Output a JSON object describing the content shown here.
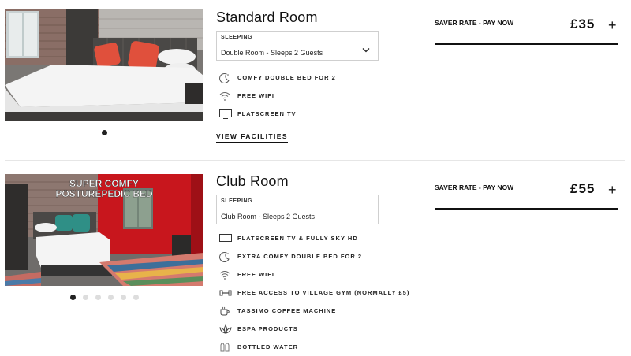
{
  "rooms": [
    {
      "title": "Standard Room",
      "sleeping_label": "SLEEPING",
      "sleeping_value": "Double Room - Sleeps 2 Guests",
      "has_dropdown": true,
      "features": [
        {
          "icon": "moon-icon",
          "text": "COMFY DOUBLE BED FOR 2"
        },
        {
          "icon": "wifi-icon",
          "text": "FREE WIFI"
        },
        {
          "icon": "tv-icon",
          "text": "FLATSCREEN TV"
        }
      ],
      "view_facilities": "VIEW FACILITIES",
      "rate_label": "SAVER RATE - PAY NOW",
      "price": "£35",
      "add_symbol": "+",
      "carousel_count": 1,
      "carousel_active": 0,
      "photo_overlay": ""
    },
    {
      "title": "Club Room",
      "sleeping_label": "SLEEPING",
      "sleeping_value": "Club Room - Sleeps 2 Guests",
      "has_dropdown": false,
      "features": [
        {
          "icon": "tv-icon",
          "text": "FLATSCREEN TV & FULLY SKY HD"
        },
        {
          "icon": "moon-icon",
          "text": "EXTRA COMFY DOUBLE BED FOR 2"
        },
        {
          "icon": "wifi-icon",
          "text": "FREE WIFI"
        },
        {
          "icon": "dumbbell-icon",
          "text": "FREE ACCESS TO VILLAGE GYM (NORMALLY £5)"
        },
        {
          "icon": "coffee-cup-icon",
          "text": "TASSIMO COFFEE MACHINE"
        },
        {
          "icon": "lotus-icon",
          "text": "ESPA PRODUCTS"
        },
        {
          "icon": "bottles-icon",
          "text": "BOTTLED WATER"
        }
      ],
      "rate_label": "SAVER RATE - PAY NOW",
      "price": "£55",
      "add_symbol": "+",
      "carousel_count": 6,
      "carousel_active": 0,
      "photo_overlay_line1": "SUPER COMFY",
      "photo_overlay_line2": "POSTUREPEDIC BED"
    }
  ],
  "colors": {
    "text": "#111111",
    "border": "#cfcfcf",
    "club_wall": "#c8161d",
    "pillow_orange": "#e0503c",
    "pillow_teal": "#2f8f86"
  }
}
